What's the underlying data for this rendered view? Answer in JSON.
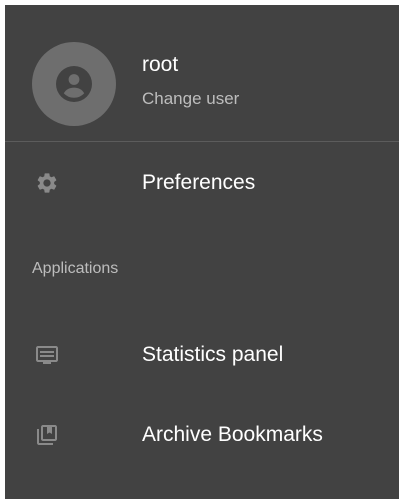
{
  "user": {
    "name": "root",
    "change_user_label": "Change user",
    "avatar_icon": "account-circle-icon"
  },
  "menu": {
    "preferences": {
      "label": "Preferences",
      "icon": "gear-icon"
    },
    "section_header": "Applications",
    "applications": [
      {
        "label": "Statistics panel",
        "icon": "monitor-icon"
      },
      {
        "label": "Archive Bookmarks",
        "icon": "bookmark-library-icon"
      }
    ]
  },
  "colors": {
    "drawer_background": "#424242",
    "text_primary": "#ffffff",
    "text_secondary": "#bdbdbd",
    "icon": "#8a8a8a",
    "avatar_background": "#6e6e6e"
  }
}
